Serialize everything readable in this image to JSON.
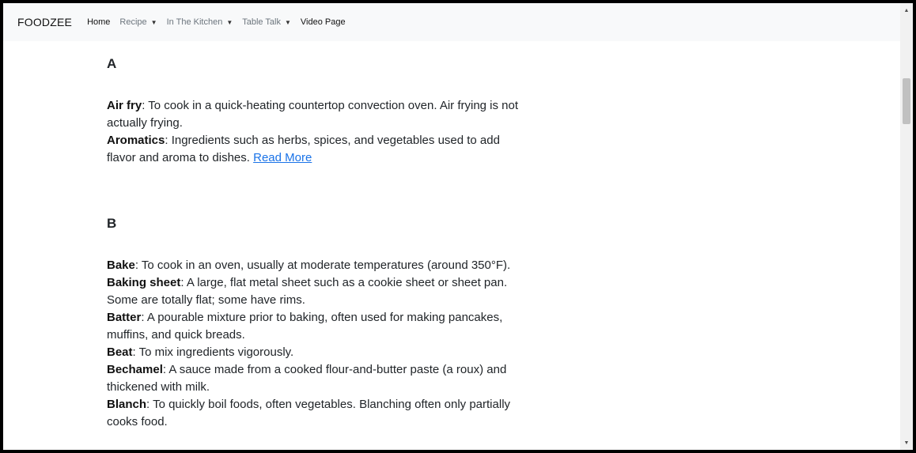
{
  "navbar": {
    "brand": "FOODZEE",
    "links": [
      {
        "label": "Home"
      },
      {
        "label": "Recipe"
      },
      {
        "label": "In The Kitchen"
      },
      {
        "label": "Table Talk"
      },
      {
        "label": "Video Page"
      }
    ]
  },
  "sections": {
    "a": {
      "letter": "A",
      "entries": [
        {
          "term": "Air fry",
          "definition": ": To cook in a quick-heating countertop convection oven. Air frying is not actually frying."
        },
        {
          "term": "Aromatics",
          "definition": ": Ingredients such as herbs, spices, and vegetables used to add flavor and aroma to dishes. "
        }
      ],
      "read_more": "Read More"
    },
    "b": {
      "letter": "B",
      "entries": [
        {
          "term": "Bake",
          "definition": ": To cook in an oven, usually at moderate temperatures (around 350°F)."
        },
        {
          "term": "Baking sheet",
          "definition": ": A large, flat metal sheet such as a cookie sheet or sheet pan. Some are totally flat; some have rims."
        },
        {
          "term": "Batter",
          "definition": ": A pourable mixture prior to baking, often used for making pancakes, muffins, and quick breads."
        },
        {
          "term": "Beat",
          "definition": ": To mix ingredients vigorously."
        },
        {
          "term": "Bechamel",
          "definition": ": A sauce made from a cooked flour-and-butter paste (a roux) and thickened with milk."
        },
        {
          "term": "Blanch",
          "definition": ": To quickly boil foods, often vegetables. Blanching often only partially cooks food."
        }
      ]
    }
  },
  "icons": {
    "caret": "caret-down-icon",
    "scroll_up": "scroll-up-arrow-icon",
    "scroll_down": "scroll-down-arrow-icon"
  }
}
